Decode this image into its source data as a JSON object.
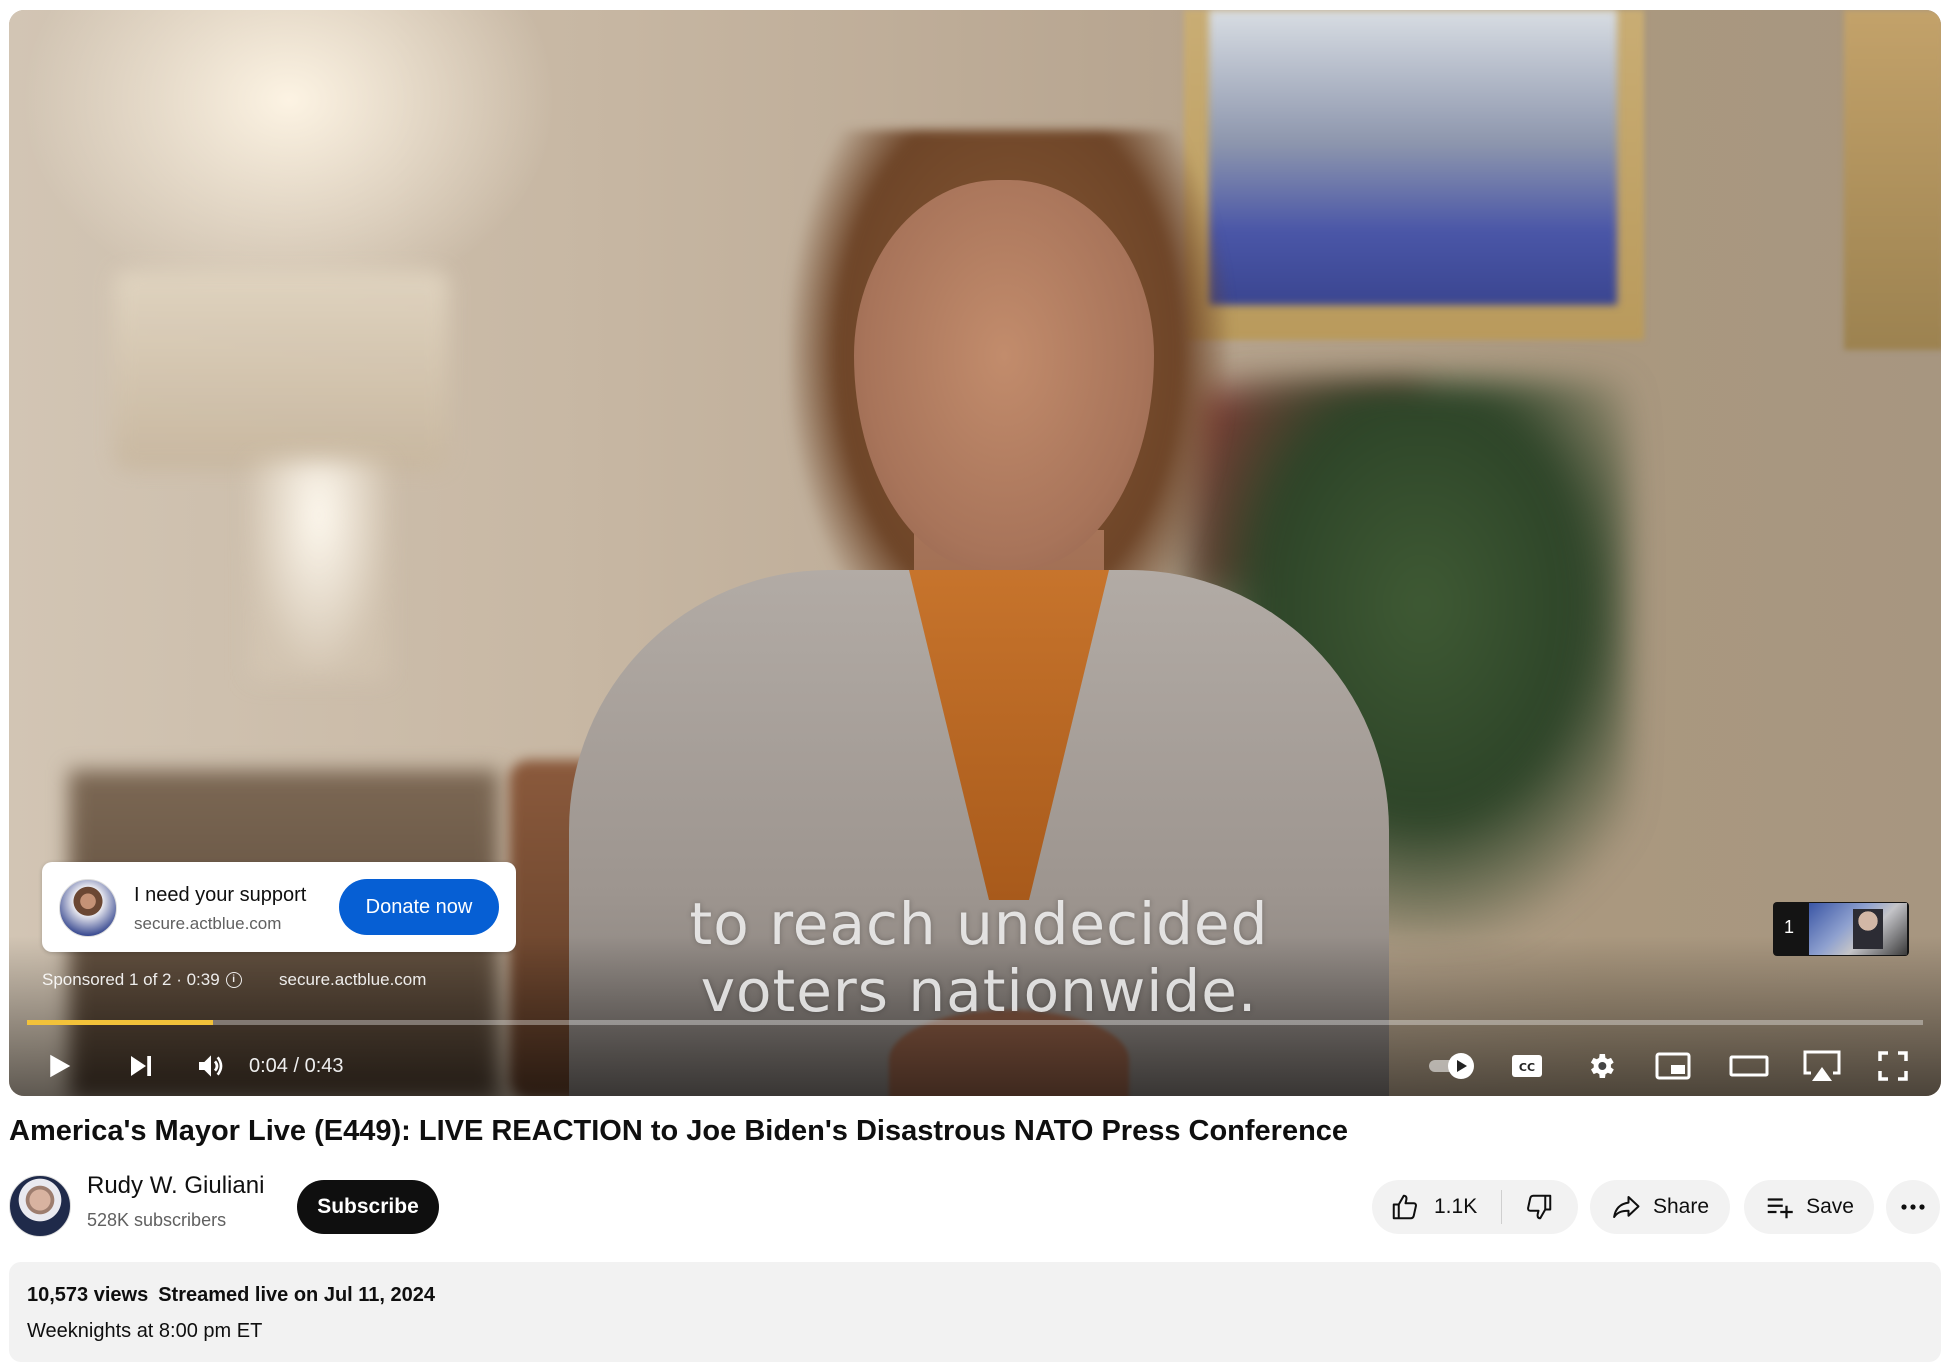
{
  "player": {
    "caption_lines": [
      "to reach undecided",
      "voters nationwide."
    ],
    "ad": {
      "title": "I need your support",
      "url": "secure.actblue.com",
      "cta": "Donate now",
      "sponsored": "Sponsored 1 of 2 · 0:39",
      "meta_url": "secure.actblue.com",
      "info_icon": "info-icon"
    },
    "ad_queue": {
      "count": "1"
    },
    "progress": {
      "fraction": 0.098,
      "color": "#f2c23a"
    },
    "time": "0:04 / 0:43",
    "controls": {
      "play": "play-icon",
      "next": "next-icon",
      "volume": "volume-icon",
      "autoplay": "autoplay-toggle-icon",
      "captions": "captions-icon",
      "settings": "gear-icon",
      "miniplayer": "miniplayer-icon",
      "theater": "theater-icon",
      "airplay": "airplay-icon",
      "fullscreen": "fullscreen-icon"
    }
  },
  "video": {
    "title": "America's Mayor Live (E449): LIVE REACTION to Joe Biden's Disastrous NATO Press Conference"
  },
  "channel": {
    "name": "Rudy W. Giuliani",
    "subscribers": "528K subscribers",
    "subscribe_label": "Subscribe"
  },
  "actions": {
    "likes": "1.1K",
    "share": "Share",
    "save": "Save"
  },
  "description": {
    "views": "10,573 views",
    "streamed": "Streamed live on Jul 11, 2024",
    "schedule": "Weeknights at 8:00 pm ET"
  },
  "colors": {
    "accent_blue": "#065fd4",
    "subscribe_bg": "#0f0f0f",
    "ad_progress": "#f2c23a"
  }
}
